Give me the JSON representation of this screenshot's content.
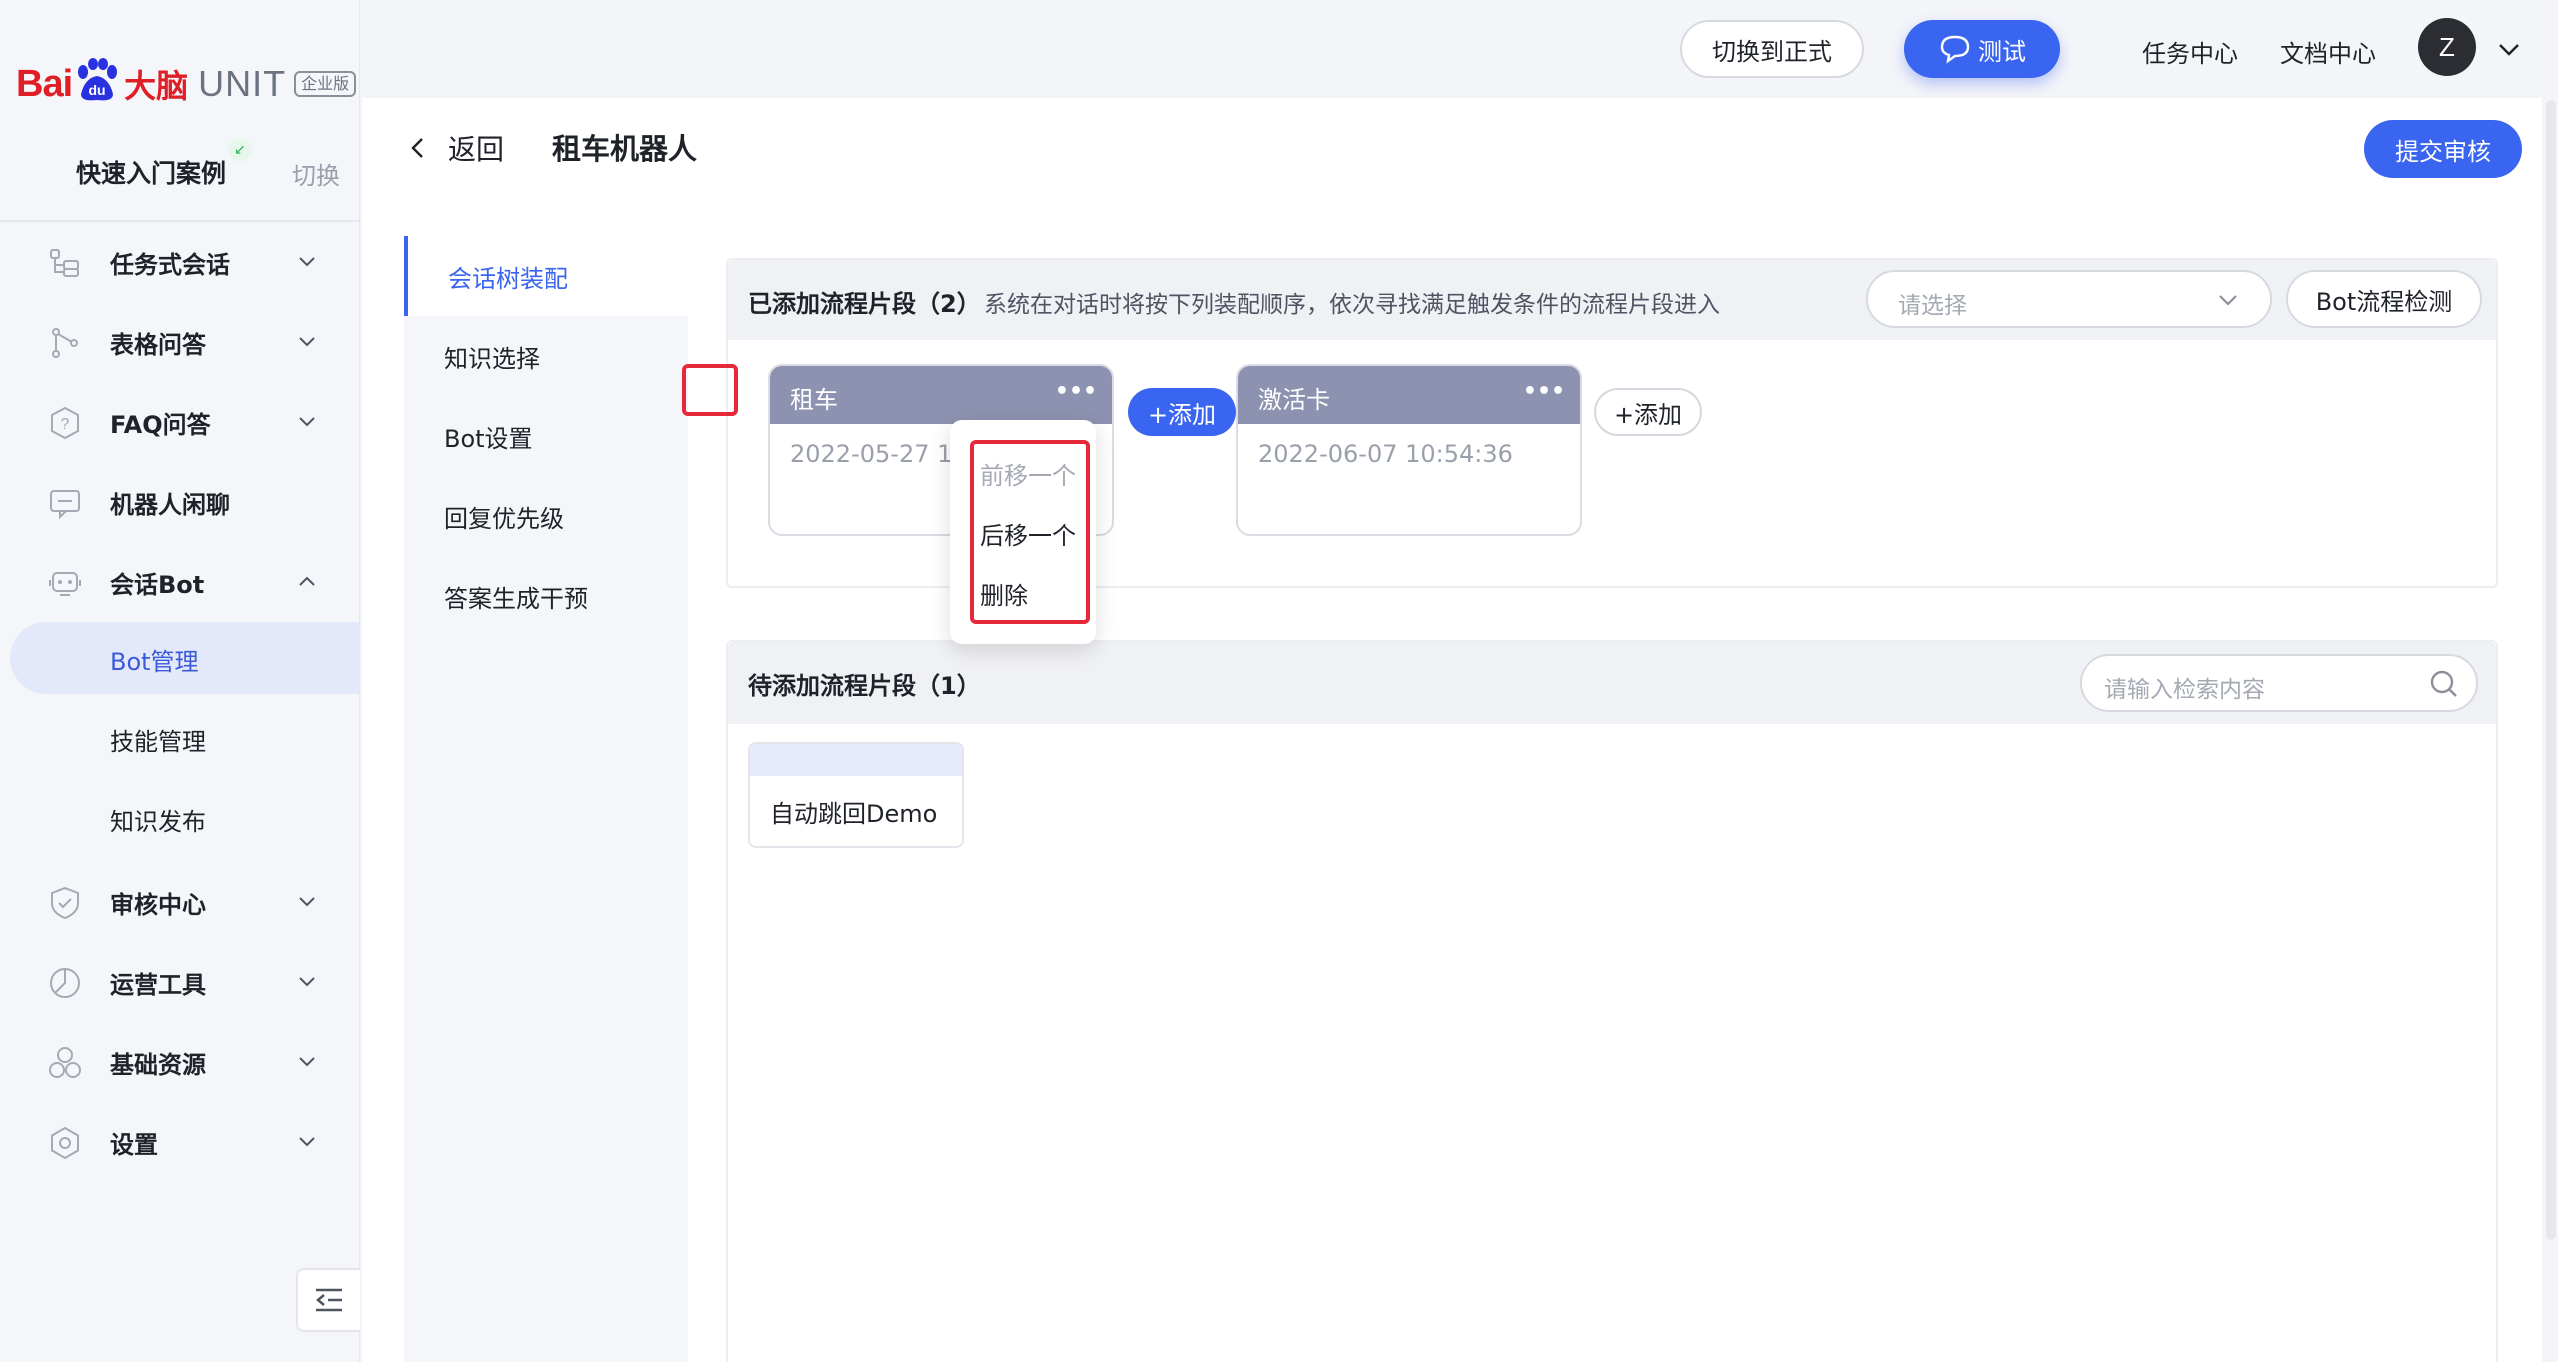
{
  "brand": {
    "logo_bai": "Bai",
    "logo_du": "du",
    "logo_daonao": "大脑",
    "logo_unit": "UNIT",
    "logo_badge": "企业版",
    "color_red": "#de1f26"
  },
  "project": {
    "name": "快速入门案例",
    "switch_label": "切换"
  },
  "sidebar": {
    "items": [
      {
        "label": "任务式会话",
        "icon": "task-dialog-icon",
        "expanded": false
      },
      {
        "label": "表格问答",
        "icon": "table-qa-icon",
        "expanded": false
      },
      {
        "label": "FAQ问答",
        "icon": "faq-icon",
        "expanded": false
      },
      {
        "label": "机器人闲聊",
        "icon": "chat-icon"
      },
      {
        "label": "会话Bot",
        "icon": "bot-icon",
        "expanded": true
      },
      {
        "label": "Bot管理",
        "sub": true,
        "active": true
      },
      {
        "label": "技能管理",
        "sub": true
      },
      {
        "label": "知识发布",
        "sub": true
      },
      {
        "label": "审核中心",
        "icon": "shield-icon",
        "expanded": false
      },
      {
        "label": "运营工具",
        "icon": "chart-icon",
        "expanded": false
      },
      {
        "label": "基础资源",
        "icon": "resource-icon",
        "expanded": false
      },
      {
        "label": "设置",
        "icon": "settings-icon",
        "expanded": false
      }
    ]
  },
  "topbar": {
    "switch_prod_label": "切换到正式",
    "test_label": "测试",
    "task_center": "任务中心",
    "doc_center": "文档中心",
    "avatar_letter": "Z"
  },
  "page": {
    "back_label": "返回",
    "title": "租车机器人",
    "submit_label": "提交审核"
  },
  "inner_nav": {
    "items": [
      {
        "label": "会话树装配",
        "active": true
      },
      {
        "label": "知识选择"
      },
      {
        "label": "Bot设置"
      },
      {
        "label": "回复优先级"
      },
      {
        "label": "答案生成干预"
      }
    ]
  },
  "added_section": {
    "title": "已添加流程片段（2）",
    "description": "系统在对话时将按下列装配顺序，依次寻找满足触发条件的流程片段进入",
    "select_placeholder": "请选择",
    "check_button": "Bot流程检测",
    "fragments": [
      {
        "name": "租车",
        "date": "2022-05-27 1"
      },
      {
        "name": "激活卡",
        "date": "2022-06-07 10:54:36"
      }
    ],
    "add_label": "+添加",
    "dots": "•••"
  },
  "dropdown_menu": {
    "items": [
      {
        "label": "前移一个",
        "disabled": true
      },
      {
        "label": "后移一个",
        "disabled": false
      },
      {
        "label": "删除",
        "disabled": false
      }
    ]
  },
  "pending_section": {
    "title": "待添加流程片段（1）",
    "search_placeholder": "请输入检索内容",
    "fragments": [
      {
        "name": "自动跳回Demo"
      }
    ]
  },
  "colors": {
    "primary": "#3965f0",
    "highlight_red": "#e5283a",
    "card_header": "#8d92b0"
  }
}
